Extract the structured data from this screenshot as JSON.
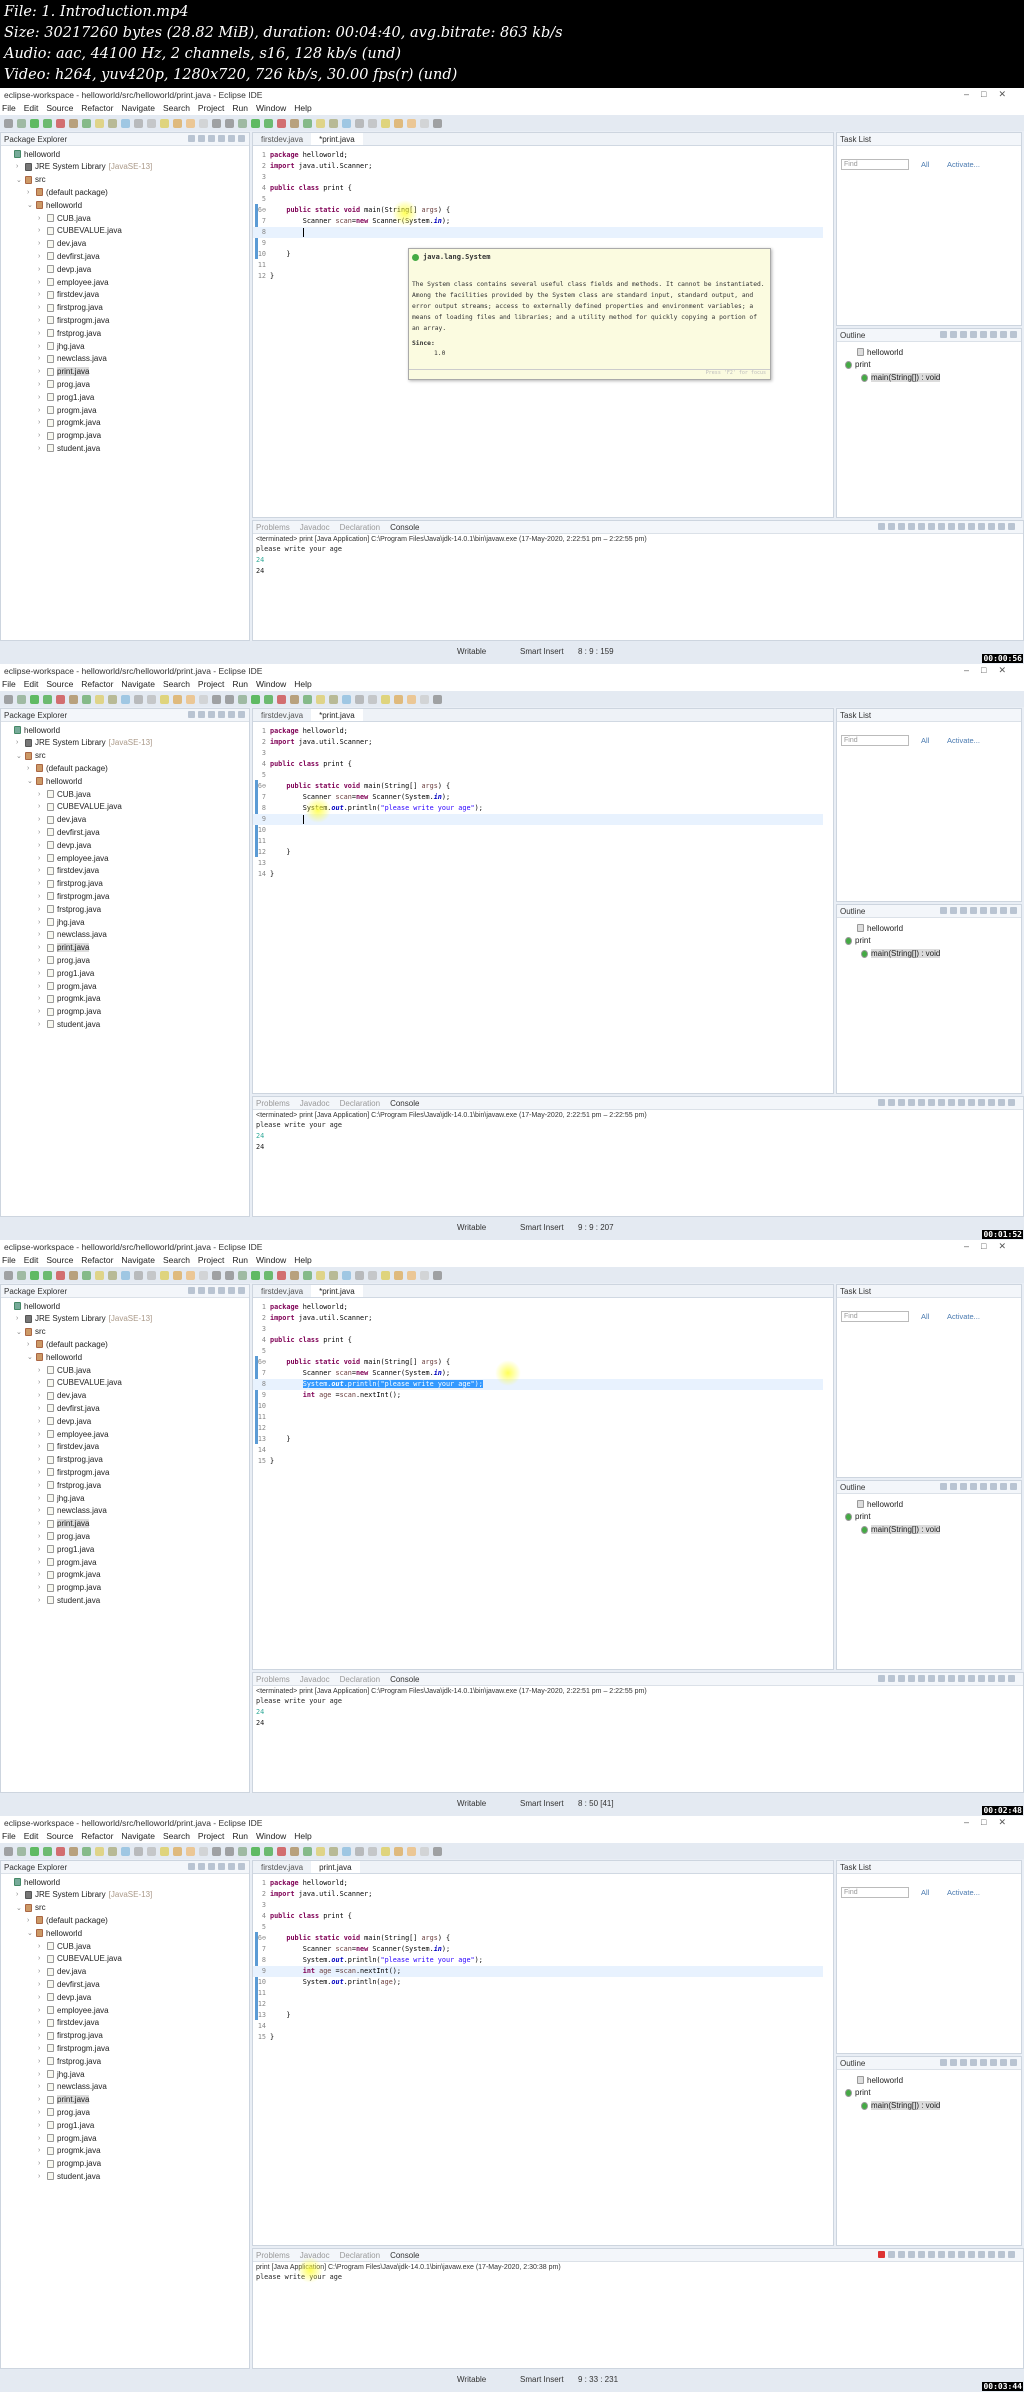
{
  "video_info": [
    "File: 1. Introduction.mp4",
    "Size: 30217260 bytes (28.82 MiB), duration: 00:04:40, avg.bitrate: 863 kb/s",
    "Audio: aac, 44100 Hz, 2 channels, s16, 128 kb/s (und)",
    "Video: h264, yuv420p, 1280x720, 726 kb/s, 30.00 fps(r) (und)"
  ],
  "ide": {
    "title": "eclipse-workspace - helloworld/src/helloworld/print.java - Eclipse IDE",
    "window_controls": [
      "–",
      "□",
      "✕"
    ],
    "menu": [
      "File",
      "Edit",
      "Source",
      "Refactor",
      "Navigate",
      "Search",
      "Project",
      "Run",
      "Window",
      "Help"
    ],
    "package_explorer": {
      "title": "Package Explorer",
      "tree": [
        {
          "label": "helloworld",
          "level": 0,
          "icon": "project-icon",
          "arrow": ""
        },
        {
          "label": "JRE System Library",
          "suffix": "[JavaSE-13]",
          "level": 1,
          "icon": "library-icon",
          "arrow": ">"
        },
        {
          "label": "src",
          "level": 1,
          "icon": "package-folder-icon",
          "arrow": "v"
        },
        {
          "label": "(default package)",
          "level": 2,
          "icon": "package-icon",
          "arrow": ">"
        },
        {
          "label": "helloworld",
          "level": 2,
          "icon": "package-icon",
          "arrow": "v"
        },
        {
          "label": "CUB.java",
          "level": 3,
          "icon": "java-file-icon",
          "arrow": ">"
        },
        {
          "label": "CUBEVALUE.java",
          "level": 3,
          "icon": "java-file-icon",
          "arrow": ">"
        },
        {
          "label": "dev.java",
          "level": 3,
          "icon": "java-file-icon",
          "arrow": ">"
        },
        {
          "label": "devfirst.java",
          "level": 3,
          "icon": "java-file-icon",
          "arrow": ">"
        },
        {
          "label": "devp.java",
          "level": 3,
          "icon": "java-file-icon",
          "arrow": ">"
        },
        {
          "label": "employee.java",
          "level": 3,
          "icon": "java-file-icon",
          "arrow": ">"
        },
        {
          "label": "firstdev.java",
          "level": 3,
          "icon": "java-file-icon",
          "arrow": ">"
        },
        {
          "label": "firstprog.java",
          "level": 3,
          "icon": "java-file-icon",
          "arrow": ">"
        },
        {
          "label": "firstprogm.java",
          "level": 3,
          "icon": "java-file-icon",
          "arrow": ">"
        },
        {
          "label": "frstprog.java",
          "level": 3,
          "icon": "java-file-icon",
          "arrow": ">"
        },
        {
          "label": "jhg.java",
          "level": 3,
          "icon": "java-file-icon",
          "arrow": ">"
        },
        {
          "label": "newclass.java",
          "level": 3,
          "icon": "java-file-icon",
          "arrow": ">"
        },
        {
          "label": "print.java",
          "level": 3,
          "icon": "java-file-icon",
          "arrow": ">",
          "selected": true
        },
        {
          "label": "prog.java",
          "level": 3,
          "icon": "java-file-icon",
          "arrow": ">"
        },
        {
          "label": "prog1.java",
          "level": 3,
          "icon": "java-file-icon",
          "arrow": ">"
        },
        {
          "label": "progm.java",
          "level": 3,
          "icon": "java-file-icon",
          "arrow": ">"
        },
        {
          "label": "progmk.java",
          "level": 3,
          "icon": "java-file-icon",
          "arrow": ">"
        },
        {
          "label": "progmp.java",
          "level": 3,
          "icon": "java-file-icon",
          "arrow": ">"
        },
        {
          "label": "student.java",
          "level": 3,
          "icon": "java-file-icon",
          "arrow": ">"
        }
      ]
    },
    "task_list": {
      "title": "Task List",
      "find_placeholder": "Find",
      "all": "All",
      "activate": "Activate..."
    },
    "outline": {
      "title": "Outline",
      "items": [
        "helloworld",
        "print",
        "main(String[]) : void"
      ]
    },
    "console_tabs": [
      "Problems",
      "Javadoc",
      "Declaration",
      "Console"
    ],
    "status": {
      "writable": "Writable",
      "insert_mode": "Smart Insert"
    }
  },
  "frames": [
    {
      "timestamp": "00:00:56",
      "tabs": [
        "firstdev.java",
        "*print.java"
      ],
      "current_line": 8,
      "selected_line": 0,
      "code": [
        "package helloworld;",
        "import java.util.Scanner;",
        "",
        "public class print {",
        "",
        "    public static void main(String[] args) {",
        "        Scanner scan=new Scanner(System.in);",
        "        ",
        "",
        "    }",
        "",
        "}"
      ],
      "caret_line": 8,
      "tooltip": {
        "title": "java.lang.System",
        "body": "The System class contains several useful class fields and methods. It cannot be instantiated. Among the facilities provided by the System class are standard input, standard output, and error output streams; access to externally defined properties and environment variables; a means of loading files and libraries; and a utility method for quickly copying a portion of an array.",
        "since_label": "Since:",
        "since_value": "1.0",
        "footer": "Press 'F2' for focus"
      },
      "console_header": "<terminated> print [Java Application] C:\\Program Files\\Java\\jdk-14.0.1\\bin\\javaw.exe  (17-May-2020, 2:22:51 pm – 2:22:55 pm)",
      "console": [
        {
          "text": "please write your age",
          "input": false
        },
        {
          "text": "24",
          "input": true
        },
        {
          "text": "24",
          "input": false
        }
      ],
      "running": false,
      "position": "8 : 9 : 159"
    },
    {
      "timestamp": "00:01:52",
      "tabs": [
        "firstdev.java",
        "*print.java"
      ],
      "current_line": 9,
      "selected_line": 0,
      "code": [
        "package helloworld;",
        "import java.util.Scanner;",
        "",
        "public class print {",
        "",
        "    public static void main(String[] args) {",
        "        Scanner scan=new Scanner(System.in);",
        "        System.out.println(\"please write your age\");",
        "        ",
        "",
        "",
        "    }",
        "",
        "}"
      ],
      "caret_line": 9,
      "console_header": "<terminated> print [Java Application] C:\\Program Files\\Java\\jdk-14.0.1\\bin\\javaw.exe  (17-May-2020, 2:22:51 pm – 2:22:55 pm)",
      "console": [
        {
          "text": "please write your age",
          "input": false
        },
        {
          "text": "24",
          "input": true
        },
        {
          "text": "24",
          "input": false
        }
      ],
      "running": false,
      "position": "9 : 9 : 207"
    },
    {
      "timestamp": "00:02:48",
      "tabs": [
        "firstdev.java",
        "*print.java"
      ],
      "current_line": 8,
      "selected_line": 8,
      "code": [
        "package helloworld;",
        "import java.util.Scanner;",
        "",
        "public class print {",
        "",
        "    public static void main(String[] args) {",
        "        Scanner scan=new Scanner(System.in);",
        "        System.out.println(\"please write your age\");",
        "        int age =scan.nextInt();",
        "",
        "",
        "",
        "    }",
        "",
        "}"
      ],
      "caret_line": 0,
      "console_header": "<terminated> print [Java Application] C:\\Program Files\\Java\\jdk-14.0.1\\bin\\javaw.exe  (17-May-2020, 2:22:51 pm – 2:22:55 pm)",
      "console": [
        {
          "text": "please write your age",
          "input": false
        },
        {
          "text": "24",
          "input": true
        },
        {
          "text": "24",
          "input": false
        }
      ],
      "running": false,
      "position": "8 : 50 [41]"
    },
    {
      "timestamp": "00:03:44",
      "tabs": [
        "firstdev.java",
        "print.java"
      ],
      "current_line": 9,
      "selected_line": 0,
      "code": [
        "package helloworld;",
        "import java.util.Scanner;",
        "",
        "public class print {",
        "",
        "    public static void main(String[] args) {",
        "        Scanner scan=new Scanner(System.in);",
        "        System.out.println(\"please write your age\");",
        "        int age =scan.nextInt();",
        "        System.out.println(age);",
        "",
        "",
        "    }",
        "",
        "}"
      ],
      "caret_line": 0,
      "console_header": "print [Java Application] C:\\Program Files\\Java\\jdk-14.0.1\\bin\\javaw.exe  (17-May-2020, 2:30:38 pm)",
      "console": [
        {
          "text": "please write your age",
          "input": false
        }
      ],
      "running": true,
      "position": "9 : 33 : 231"
    }
  ],
  "colors": {
    "keyword": "#7f0055",
    "string": "#2a00ff",
    "field": "#0000c0",
    "selection": "#3399ff",
    "tooltip_bg": "#fbfbe0"
  }
}
